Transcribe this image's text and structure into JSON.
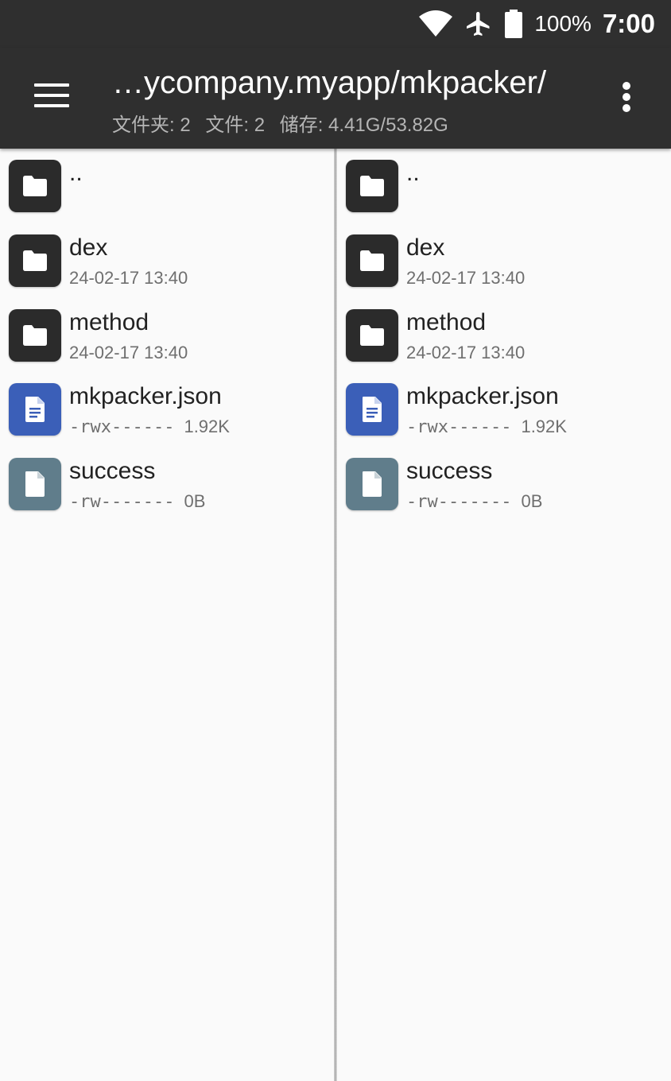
{
  "status_bar": {
    "icons": [
      "wifi-icon",
      "airplane-mode-icon",
      "battery-icon"
    ],
    "battery": "100%",
    "time": "7:00"
  },
  "app_bar": {
    "title": "…ycompany.myapp/mkpacker/",
    "subtitle": {
      "folders": "文件夹: 2",
      "files": "文件: 2",
      "storage": "储存: 4.41G/53.82G"
    }
  },
  "panes": [
    {
      "items": [
        {
          "name": "..",
          "type": "folder"
        },
        {
          "name": "dex",
          "type": "folder",
          "date": "24-02-17 13:40"
        },
        {
          "name": "method",
          "type": "folder",
          "date": "24-02-17 13:40"
        },
        {
          "name": "mkpacker.json",
          "type": "document",
          "perm": "-rwx------",
          "size": "1.92K"
        },
        {
          "name": "success",
          "type": "file",
          "perm": "-rw-------",
          "size": "0B"
        }
      ]
    },
    {
      "items": [
        {
          "name": "..",
          "type": "folder"
        },
        {
          "name": "dex",
          "type": "folder",
          "date": "24-02-17 13:40"
        },
        {
          "name": "method",
          "type": "folder",
          "date": "24-02-17 13:40"
        },
        {
          "name": "mkpacker.json",
          "type": "document",
          "perm": "-rwx------",
          "size": "1.92K"
        },
        {
          "name": "success",
          "type": "file",
          "perm": "-rw-------",
          "size": "0B"
        }
      ]
    }
  ],
  "colors": {
    "bar": "#2f2f2f",
    "folder_icon_bg": "#2b2b2b",
    "document_icon_bg": "#3b5fb8",
    "file_icon_bg": "#607d8b",
    "background": "#fafafa"
  }
}
